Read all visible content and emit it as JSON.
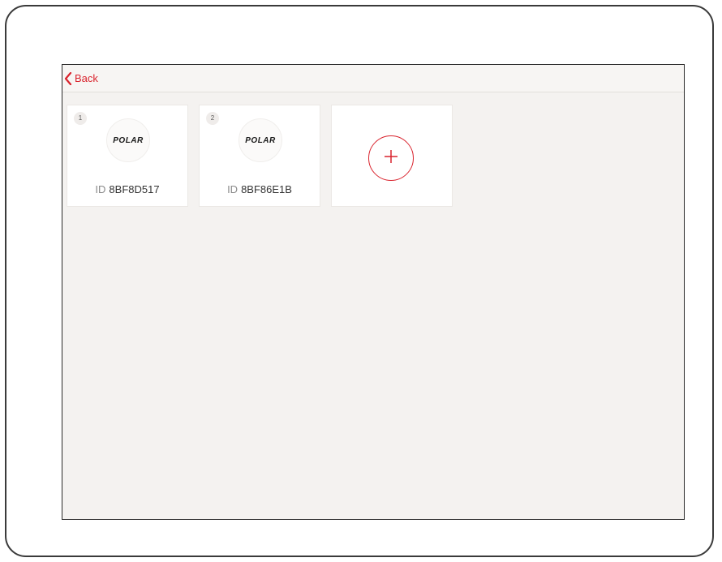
{
  "navbar": {
    "back_label": "Back"
  },
  "sensors": [
    {
      "index": "1",
      "brand": "POLAR",
      "id_prefix": "ID",
      "id_value": "8BF8D517"
    },
    {
      "index": "2",
      "brand": "POLAR",
      "id_prefix": "ID",
      "id_value": "8BF86E1B"
    }
  ],
  "add_sensor": {
    "icon": "plus-icon"
  },
  "colors": {
    "accent": "#d9232d",
    "background": "#f4f2f0",
    "card": "#ffffff"
  }
}
